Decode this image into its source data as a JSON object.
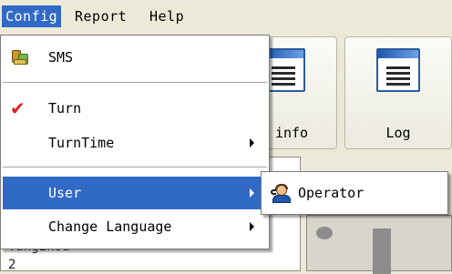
{
  "menubar": {
    "items": [
      {
        "label": "Config"
      },
      {
        "label": "Report"
      },
      {
        "label": "Help"
      }
    ]
  },
  "toolbar": {
    "buttons": [
      {
        "label": "n info",
        "icon": "window-list-icon"
      },
      {
        "label": "Log",
        "icon": "window-list-icon"
      }
    ]
  },
  "config_menu": {
    "items": [
      {
        "label": "SMS",
        "icon": "sms-icon"
      },
      {
        "label": "Turn",
        "icon": "checkmark-icon",
        "checked": true
      },
      {
        "label": "TurnTime",
        "submenu": true
      },
      {
        "label": "User",
        "submenu": true,
        "highlighted": true
      },
      {
        "label": "Change Language",
        "submenu": true
      }
    ]
  },
  "user_submenu": {
    "items": [
      {
        "label": "Operator",
        "icon": "operator-icon"
      }
    ]
  },
  "panel": {
    "text1": "Tangzhou",
    "text2": "2"
  },
  "colors": {
    "highlight": "#316ac5",
    "check": "#e02020",
    "window_bg": "#ece9d8"
  }
}
